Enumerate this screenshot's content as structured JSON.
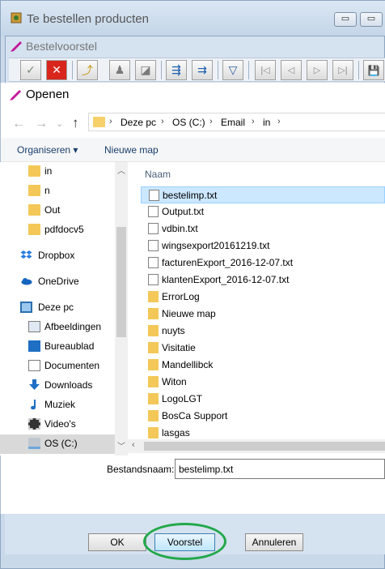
{
  "outer_window": {
    "title": "Te bestellen producten",
    "minimize_symbol": "▭",
    "maximize_symbol": "▭"
  },
  "inner_window": {
    "title": "Bestelvoorstel",
    "toolbar": [
      {
        "icon": "check-icon",
        "glyph": "✓"
      },
      {
        "icon": "close-x-icon",
        "glyph": "✕"
      },
      {
        "icon": "folder-open-icon",
        "glyph": "⤴"
      },
      {
        "icon": "stamp-icon",
        "glyph": "♟"
      },
      {
        "icon": "page-icon",
        "glyph": "◪"
      },
      {
        "icon": "flow-split-icon",
        "glyph": "⇶"
      },
      {
        "icon": "flow-merge-icon",
        "glyph": "⇉"
      },
      {
        "icon": "funnel-icon",
        "glyph": "▽"
      },
      {
        "icon": "first-record-icon",
        "glyph": "|◁"
      },
      {
        "icon": "prev-record-icon",
        "glyph": "◁"
      },
      {
        "icon": "next-record-icon",
        "glyph": "▷"
      },
      {
        "icon": "last-record-icon",
        "glyph": "▷|"
      },
      {
        "icon": "save-icon",
        "glyph": "💾"
      }
    ]
  },
  "dialog": {
    "title": "Openen",
    "nav": {
      "back": "←",
      "forward": "→",
      "recent": "⌄",
      "up": "↑"
    },
    "breadcrumb": [
      "Deze pc",
      "OS (C:)",
      "Email",
      "in"
    ],
    "crumb_separator": "›",
    "commands": {
      "organize": "Organiseren ▾",
      "new_folder": "Nieuwe map"
    },
    "tree": [
      {
        "label": "in",
        "icon": "folder-icon",
        "indent": 2
      },
      {
        "label": "n",
        "icon": "folder-icon",
        "indent": 2
      },
      {
        "label": "Out",
        "icon": "folder-icon",
        "indent": 2
      },
      {
        "label": "pdfdocv5",
        "icon": "folder-icon",
        "indent": 2
      },
      {
        "label": "Dropbox",
        "icon": "dropbox-icon",
        "indent": 1
      },
      {
        "label": "OneDrive",
        "icon": "onedrive-icon",
        "indent": 1
      },
      {
        "label": "Deze pc",
        "icon": "computer-icon",
        "indent": 1
      },
      {
        "label": "Afbeeldingen",
        "icon": "pictures-icon",
        "indent": 2
      },
      {
        "label": "Bureaublad",
        "icon": "desktop-icon",
        "indent": 2
      },
      {
        "label": "Documenten",
        "icon": "documents-icon",
        "indent": 2
      },
      {
        "label": "Downloads",
        "icon": "downloads-icon",
        "indent": 2
      },
      {
        "label": "Muziek",
        "icon": "music-icon",
        "indent": 2
      },
      {
        "label": "Video's",
        "icon": "videos-icon",
        "indent": 2
      },
      {
        "label": "OS (C:)",
        "icon": "drive-icon",
        "indent": 2,
        "selected": true
      }
    ],
    "column_header": "Naam",
    "files": [
      {
        "name": "bestelimp.txt",
        "type": "txt",
        "selected": true
      },
      {
        "name": "Output.txt",
        "type": "txt"
      },
      {
        "name": "vdbin.txt",
        "type": "txt"
      },
      {
        "name": "wingsexport20161219.txt",
        "type": "txt"
      },
      {
        "name": "facturenExport_2016-12-07.txt",
        "type": "txt"
      },
      {
        "name": "klantenExport_2016-12-07.txt",
        "type": "txt"
      },
      {
        "name": "ErrorLog",
        "type": "folder"
      },
      {
        "name": "Nieuwe map",
        "type": "folder"
      },
      {
        "name": "nuyts",
        "type": "folder"
      },
      {
        "name": "Visitatie",
        "type": "folder"
      },
      {
        "name": "Mandellibck",
        "type": "folder"
      },
      {
        "name": "Witon",
        "type": "folder"
      },
      {
        "name": "LogoLGT",
        "type": "folder"
      },
      {
        "name": "BosCa Support",
        "type": "folder"
      },
      {
        "name": "lasgas",
        "type": "folder"
      }
    ],
    "filename_label": "Bestandsnaam:",
    "filename_value": "bestelimp.txt"
  },
  "buttons": {
    "ok": "OK",
    "voorstel": "Voorstel",
    "annuleren": "Annuleren"
  },
  "colors": {
    "highlight_ring": "#22a84a",
    "selection": "#cce8ff"
  }
}
